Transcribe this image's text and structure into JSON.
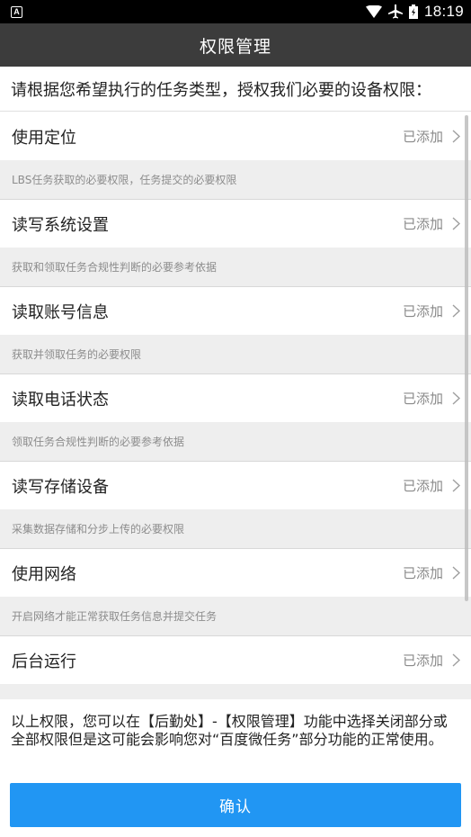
{
  "status_bar": {
    "notification_icon": "A",
    "time": "18:19",
    "icons": [
      "wifi-icon",
      "airplane-icon",
      "battery-icon"
    ]
  },
  "app_bar": {
    "title": "权限管理"
  },
  "intro": {
    "text": "请根据您希望执行的任务类型，授权我们必要的设备权限："
  },
  "permissions": [
    {
      "name": "使用定位",
      "status": "已添加",
      "desc": "LBS任务获取的必要权限，任务提交的必要权限"
    },
    {
      "name": "读写系统设置",
      "status": "已添加",
      "desc": "获取和领取任务合规性判断的必要参考依据"
    },
    {
      "name": "读取账号信息",
      "status": "已添加",
      "desc": "获取并领取任务的必要权限"
    },
    {
      "name": "读取电话状态",
      "status": "已添加",
      "desc": "领取任务合规性判断的必要参考依据"
    },
    {
      "name": "读写存储设备",
      "status": "已添加",
      "desc": "采集数据存储和分步上传的必要权限"
    },
    {
      "name": "使用网络",
      "status": "已添加",
      "desc": "开启网络才能正常获取任务信息并提交任务"
    },
    {
      "name": "后台运行",
      "status": "已添加",
      "desc": ""
    }
  ],
  "footer": {
    "note": "以上权限，您可以在【后勤处】-【权限管理】功能中选择关闭部分或全部权限但是这可能会影响您对“百度微任务”部分功能的正常使用。",
    "confirm_label": "确认"
  },
  "colors": {
    "app_bar": "#3c3c3c",
    "button": "#2196f3",
    "desc_bg": "#eeeeee"
  }
}
